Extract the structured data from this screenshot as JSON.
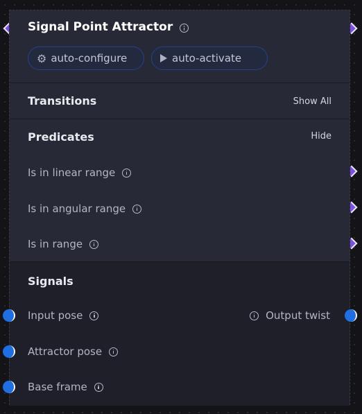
{
  "node": {
    "title": "Signal Point Attractor",
    "buttons": {
      "configure_label": "auto-configure",
      "activate_label": "auto-activate"
    }
  },
  "transitions": {
    "title": "Transitions",
    "action": "Show All"
  },
  "predicates": {
    "title": "Predicates",
    "action": "Hide",
    "items": [
      {
        "label": "Is in linear range"
      },
      {
        "label": "Is in angular range"
      },
      {
        "label": "Is in range"
      }
    ]
  },
  "signals": {
    "title": "Signals",
    "inputs": [
      {
        "label": "Input pose"
      },
      {
        "label": "Attractor pose"
      },
      {
        "label": "Base frame"
      }
    ],
    "outputs": [
      {
        "label": "Output twist"
      }
    ]
  },
  "colors": {
    "accent_blue": "#1f6fe0",
    "accent_purple": "#7b4fe0",
    "panel": "#272a36"
  },
  "icons": {
    "info": "info-icon",
    "gear": "gear-icon",
    "play": "play-icon"
  }
}
